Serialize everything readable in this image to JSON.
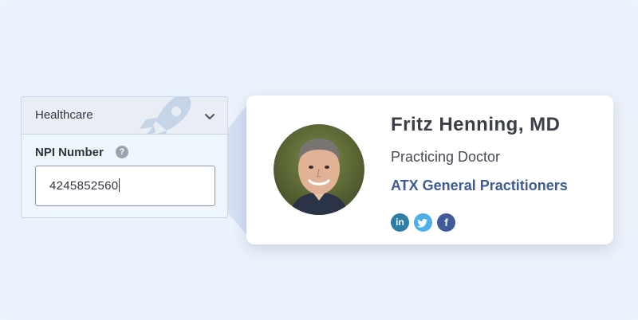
{
  "form": {
    "category_select": {
      "value": "Healthcare",
      "icon": "chevron-down-icon"
    },
    "npi": {
      "label": "NPI Number",
      "help_icon": "question-icon",
      "help_glyph": "?",
      "value": "4245852560"
    },
    "decoration_icon": "rocket-icon"
  },
  "profile": {
    "name": "Fritz Henning, MD",
    "role": "Practicing Doctor",
    "organization": "ATX General Practitioners",
    "socials": [
      {
        "network": "linkedin",
        "glyph": "in",
        "icon": "linkedin-icon",
        "color": "#2f7ea4"
      },
      {
        "network": "twitter",
        "glyph": "",
        "icon": "twitter-icon",
        "color": "#4cb0ea"
      },
      {
        "network": "facebook",
        "glyph": "f",
        "icon": "facebook-icon",
        "color": "#3f5b9a"
      }
    ]
  },
  "colors": {
    "background": "#ecf2fb",
    "accent": "#3e5b93",
    "panel_border": "#c5d6ee",
    "beam": "#cfdcf1"
  }
}
